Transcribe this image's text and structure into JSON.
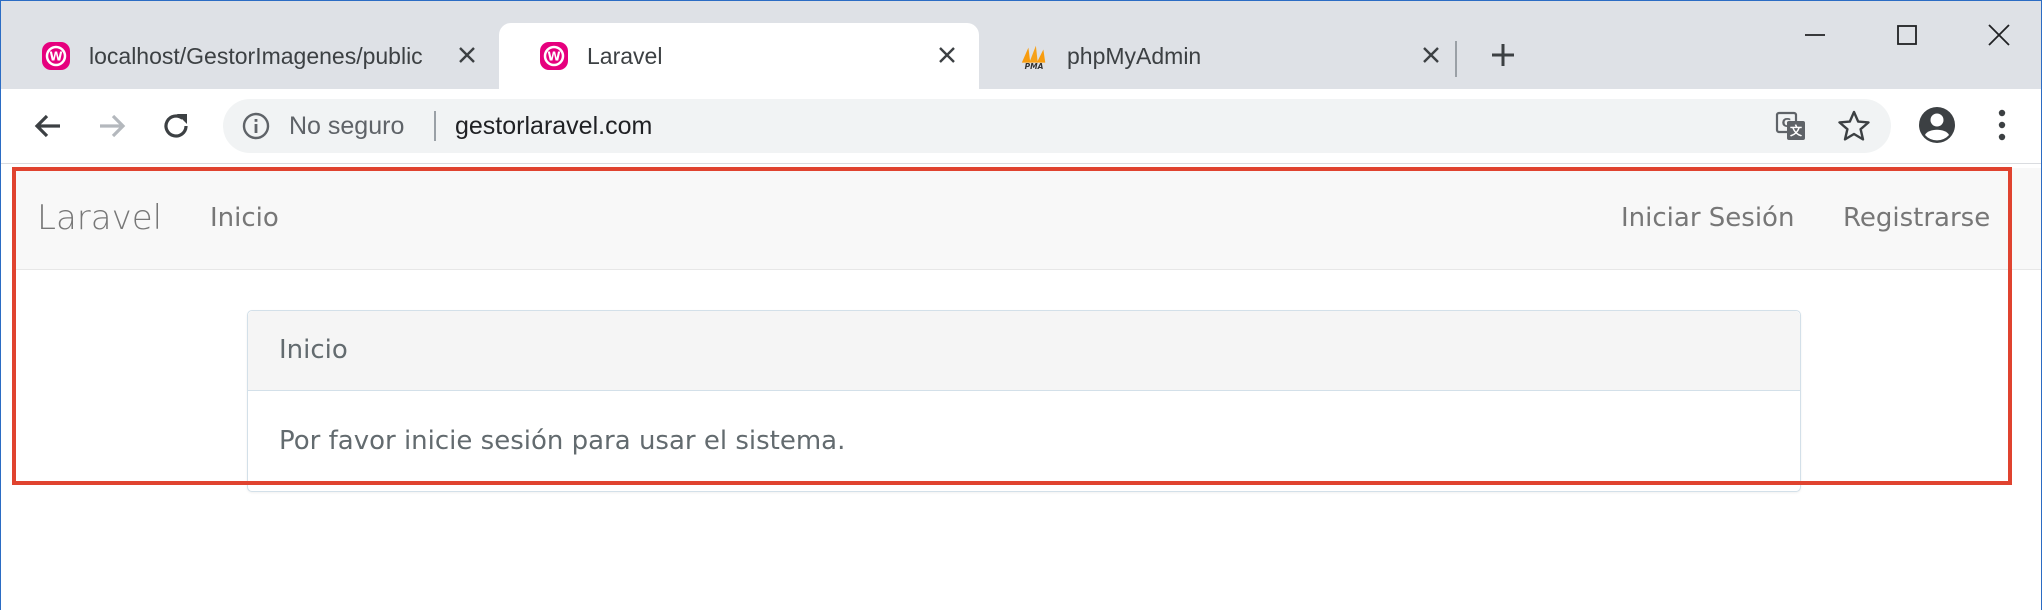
{
  "browser": {
    "tabs": [
      {
        "title": "localhost/GestorImagenes/public",
        "favicon": "wamp-icon",
        "active": false
      },
      {
        "title": "Laravel",
        "favicon": "wamp-icon",
        "active": true
      },
      {
        "title": "phpMyAdmin",
        "favicon": "phpmyadmin-icon",
        "active": false
      }
    ],
    "address": {
      "security_label": "No seguro",
      "url": "gestorlaravel.com"
    },
    "colors": {
      "tab_strip": "#dee1e6",
      "omnibox": "#f1f3f4",
      "wamp_favicon": "#e6007e",
      "highlight": "#e0432f"
    }
  },
  "page": {
    "navbar": {
      "brand": "Laravel",
      "left_links": [
        "Inicio"
      ],
      "right_links": [
        "Iniciar Sesión",
        "Registrarse"
      ]
    },
    "card": {
      "header": "Inicio",
      "body": "Por favor inicie sesión para usar el sistema."
    }
  }
}
